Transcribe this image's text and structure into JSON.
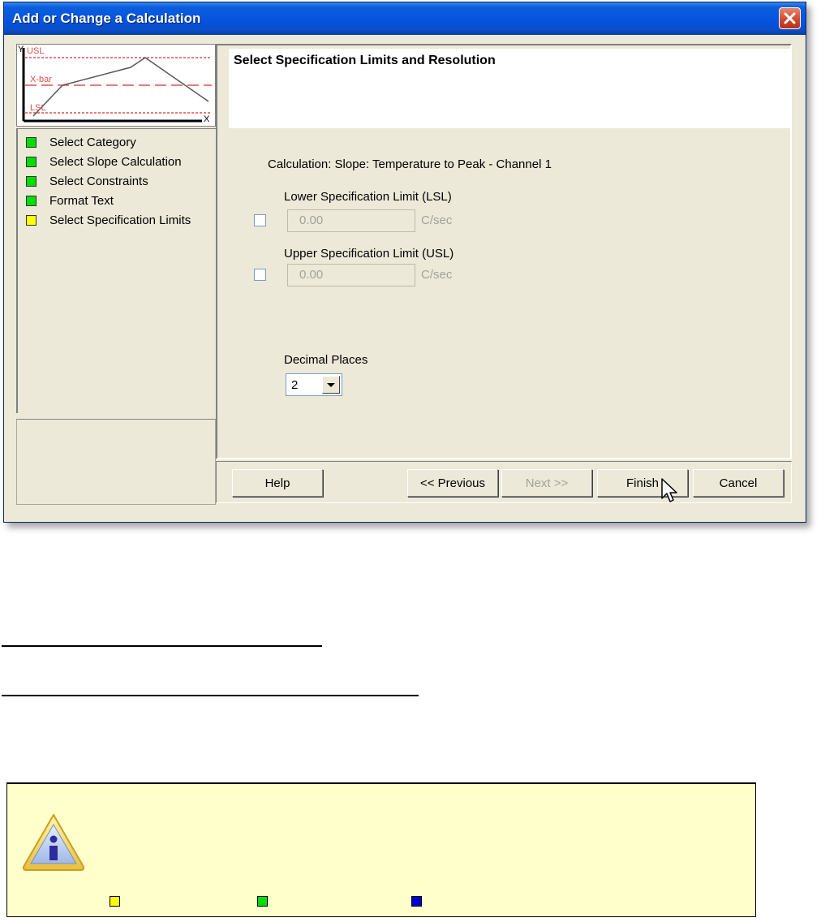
{
  "window": {
    "title": "Add or Change a Calculation"
  },
  "thumbnail": {
    "y_label": "Y",
    "x_label": "X",
    "usl_label": "USL",
    "xbar_label": "X-bar",
    "lsl_label": "LSL"
  },
  "steps": [
    {
      "label": "Select Category",
      "status_color": "#00dd00"
    },
    {
      "label": "Select Slope Calculation",
      "status_color": "#00dd00"
    },
    {
      "label": "Select Constraints",
      "status_color": "#00dd00"
    },
    {
      "label": "Format Text",
      "status_color": "#00dd00"
    },
    {
      "label": "Select Specification Limits",
      "status_color": "#ffff00"
    }
  ],
  "page": {
    "header": "Select Specification Limits and Resolution",
    "calculation": "Calculation: Slope: Temperature to Peak - Channel 1",
    "lsl": {
      "label": "Lower Specification Limit (LSL)",
      "value": "0.00",
      "unit": "C/sec",
      "checked": false
    },
    "usl": {
      "label": "Upper Specification Limit (USL)",
      "value": "0.00",
      "unit": "C/sec",
      "checked": false
    },
    "decimal": {
      "label": "Decimal Places",
      "value": "2"
    }
  },
  "buttons": {
    "help": "Help",
    "previous": "<< Previous",
    "next": "Next >>",
    "finish": "Finish",
    "cancel": "Cancel"
  },
  "note": {
    "legend_colors": [
      "#ffff00",
      "#00dd00",
      "#0000cc"
    ]
  }
}
